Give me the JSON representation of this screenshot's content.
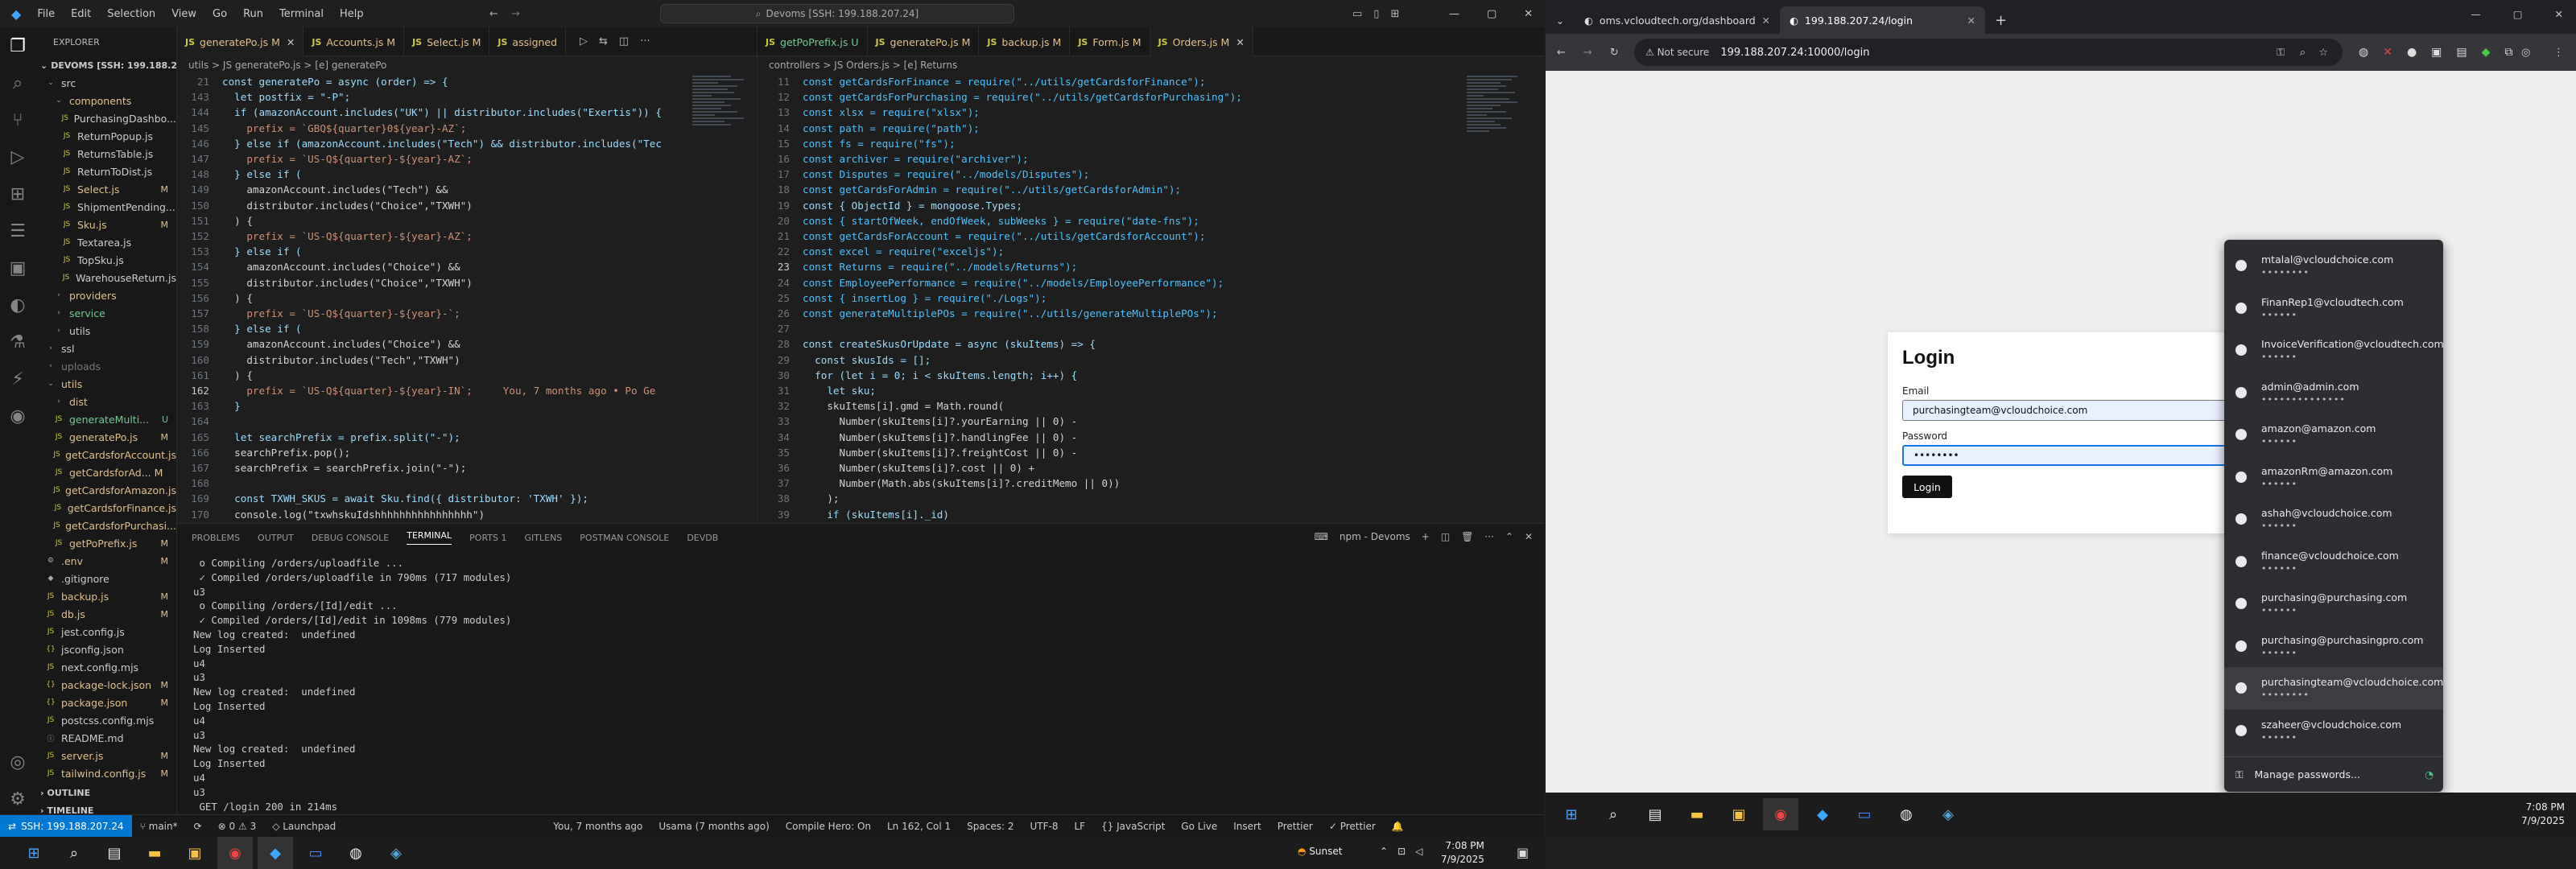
{
  "vscode": {
    "menu": [
      "File",
      "Edit",
      "Selection",
      "View",
      "Go",
      "Run",
      "Terminal",
      "Help"
    ],
    "command_center": "Devoms [SSH: 199.188.207.24]",
    "explorer_title": "EXPLORER",
    "workspace": "DEVOMS [SSH: 199.188.20...",
    "tree": [
      {
        "label": "src",
        "indent": 1,
        "color": "#ccc",
        "badge": "",
        "icon": "folder-open-icon"
      },
      {
        "label": "components",
        "indent": 2,
        "color": "#e2c08d",
        "badge": "",
        "icon": "folder-open-icon"
      },
      {
        "label": "PurchasingDashbo...",
        "indent": 3,
        "color": "#ccc",
        "badge": "",
        "icon": "js-file-icon"
      },
      {
        "label": "ReturnPopup.js",
        "indent": 3,
        "color": "#ccc",
        "badge": "",
        "icon": "js-file-icon"
      },
      {
        "label": "ReturnsTable.js",
        "indent": 3,
        "color": "#ccc",
        "badge": "",
        "icon": "js-file-icon"
      },
      {
        "label": "ReturnToDist.js",
        "indent": 3,
        "color": "#ccc",
        "badge": "",
        "icon": "js-file-icon"
      },
      {
        "label": "Select.js",
        "indent": 3,
        "color": "#e2c08d",
        "badge": "M",
        "icon": "js-file-icon"
      },
      {
        "label": "ShipmentPending...",
        "indent": 3,
        "color": "#ccc",
        "badge": "",
        "icon": "js-file-icon"
      },
      {
        "label": "Sku.js",
        "indent": 3,
        "color": "#e2c08d",
        "badge": "M",
        "icon": "js-file-icon"
      },
      {
        "label": "Textarea.js",
        "indent": 3,
        "color": "#ccc",
        "badge": "",
        "icon": "js-file-icon"
      },
      {
        "label": "TopSku.js",
        "indent": 3,
        "color": "#ccc",
        "badge": "",
        "icon": "js-file-icon"
      },
      {
        "label": "WarehouseReturn.js",
        "indent": 3,
        "color": "#ccc",
        "badge": "",
        "icon": "js-file-icon"
      },
      {
        "label": "providers",
        "indent": 2,
        "color": "#e2c08d",
        "badge": "",
        "icon": "folder-icon"
      },
      {
        "label": "service",
        "indent": 2,
        "color": "#73c991",
        "badge": "",
        "icon": "folder-icon"
      },
      {
        "label": "utils",
        "indent": 2,
        "color": "#ccc",
        "badge": "",
        "icon": "folder-icon"
      },
      {
        "label": "ssl",
        "indent": 1,
        "color": "#ccc",
        "badge": "",
        "icon": "folder-icon"
      },
      {
        "label": "uploads",
        "indent": 1,
        "color": "#777",
        "badge": "",
        "icon": "folder-icon"
      },
      {
        "label": "utils",
        "indent": 1,
        "color": "#e2c08d",
        "badge": "",
        "icon": "folder-open-icon"
      },
      {
        "label": "dist",
        "indent": 2,
        "color": "#e2c08d",
        "badge": "",
        "icon": "folder-icon"
      },
      {
        "label": "generateMulti...",
        "indent": 2,
        "color": "#73c991",
        "badge": "U",
        "icon": "js-file-icon"
      },
      {
        "label": "generatePo.js",
        "indent": 2,
        "color": "#e2c08d",
        "badge": "M",
        "icon": "js-file-icon"
      },
      {
        "label": "getCardsforAccount.js",
        "indent": 2,
        "color": "#e2c08d",
        "badge": "",
        "icon": "js-file-icon"
      },
      {
        "label": "getCardsforAd... M",
        "indent": 2,
        "color": "#e2c08d",
        "badge": "",
        "icon": "js-file-icon"
      },
      {
        "label": "getCardsforAmazon.js",
        "indent": 2,
        "color": "#e2c08d",
        "badge": "",
        "icon": "js-file-icon"
      },
      {
        "label": "getCardsforFinance.js",
        "indent": 2,
        "color": "#e2c08d",
        "badge": "",
        "icon": "js-file-icon"
      },
      {
        "label": "getCardsforPurchasi...",
        "indent": 2,
        "color": "#e2c08d",
        "badge": "",
        "icon": "js-file-icon"
      },
      {
        "label": "getPoPrefix.js",
        "indent": 2,
        "color": "#e2c08d",
        "badge": "M",
        "icon": "js-file-icon"
      },
      {
        "label": ".env",
        "indent": 1,
        "color": "#e2c08d",
        "badge": "M",
        "icon": "gear-icon"
      },
      {
        "label": ".gitignore",
        "indent": 1,
        "color": "#ccc",
        "badge": "",
        "icon": "git-icon"
      },
      {
        "label": "backup.js",
        "indent": 1,
        "color": "#e2c08d",
        "badge": "M",
        "icon": "js-file-icon"
      },
      {
        "label": "db.js",
        "indent": 1,
        "color": "#e2c08d",
        "badge": "M",
        "icon": "js-file-icon"
      },
      {
        "label": "jest.config.js",
        "indent": 1,
        "color": "#ccc",
        "badge": "",
        "icon": "js-file-icon"
      },
      {
        "label": "jsconfig.json",
        "indent": 1,
        "color": "#ccc",
        "badge": "",
        "icon": "json-file-icon"
      },
      {
        "label": "next.config.mjs",
        "indent": 1,
        "color": "#ccc",
        "badge": "",
        "icon": "js-file-icon"
      },
      {
        "label": "package-lock.json",
        "indent": 1,
        "color": "#e2c08d",
        "badge": "M",
        "icon": "json-file-icon"
      },
      {
        "label": "package.json",
        "indent": 1,
        "color": "#e2c08d",
        "badge": "M",
        "icon": "json-file-icon"
      },
      {
        "label": "postcss.config.mjs",
        "indent": 1,
        "color": "#ccc",
        "badge": "",
        "icon": "js-file-icon"
      },
      {
        "label": "README.md",
        "indent": 1,
        "color": "#ccc",
        "badge": "",
        "icon": "info-icon"
      },
      {
        "label": "server.js",
        "indent": 1,
        "color": "#e2c08d",
        "badge": "M",
        "icon": "js-file-icon"
      },
      {
        "label": "tailwind.config.js",
        "indent": 1,
        "color": "#e2c08d",
        "badge": "M",
        "icon": "js-file-icon"
      }
    ],
    "outline": "OUTLINE",
    "timeline": "TIMELINE",
    "left_tabs": [
      "generatePo.js M",
      "Accounts.js M",
      "Select.js M",
      "assigned"
    ],
    "right_tabs": [
      "getPoPrefix.js U",
      "generatePo.js M",
      "backup.js M",
      "Form.js M",
      "Orders.js M"
    ],
    "left_breadcrumb": "utils > JS generatePo.js > [e] generatePo",
    "right_breadcrumb": "controllers > JS Orders.js > [e] Returns",
    "left_lines": [
      {
        "n": "21",
        "t": "const generatePo = async (order) => {"
      },
      {
        "n": "143",
        "t": "  let postfix = \"-P\";"
      },
      {
        "n": "144",
        "t": "  if (amazonAccount.includes(\"UK\") || distributor.includes(\"Exertis\")) {"
      },
      {
        "n": "145",
        "t": "    prefix = `GBQ${quarter}0${year}-AZ`;"
      },
      {
        "n": "146",
        "t": "  } else if (amazonAccount.includes(\"Tech\") && distributor.includes(\"Tec"
      },
      {
        "n": "147",
        "t": "    prefix = `US-Q${quarter}-${year}-AZ`;"
      },
      {
        "n": "148",
        "t": "  } else if ("
      },
      {
        "n": "149",
        "t": "    amazonAccount.includes(\"Tech\") &&"
      },
      {
        "n": "150",
        "t": "    distributor.includes(\"Choice\",\"TXWH\")"
      },
      {
        "n": "151",
        "t": "  ) {"
      },
      {
        "n": "152",
        "t": "    prefix = `US-Q${quarter}-${year}-AZ`;"
      },
      {
        "n": "153",
        "t": "  } else if ("
      },
      {
        "n": "154",
        "t": "    amazonAccount.includes(\"Choice\") &&"
      },
      {
        "n": "155",
        "t": "    distributor.includes(\"Choice\",\"TXWH\")"
      },
      {
        "n": "156",
        "t": "  ) {"
      },
      {
        "n": "157",
        "t": "    prefix = `US-Q${quarter}-${year}-`;"
      },
      {
        "n": "158",
        "t": "  } else if ("
      },
      {
        "n": "159",
        "t": "    amazonAccount.includes(\"Choice\") &&"
      },
      {
        "n": "160",
        "t": "    distributor.includes(\"Tech\",\"TXWH\")"
      },
      {
        "n": "161",
        "t": "  ) {"
      },
      {
        "n": "162",
        "t": "    prefix = `US-Q${quarter}-${year}-IN`;     You, 7 months ago • Po Ge"
      },
      {
        "n": "163",
        "t": "  }"
      },
      {
        "n": "164",
        "t": ""
      },
      {
        "n": "165",
        "t": "  let searchPrefix = prefix.split(\"-\");"
      },
      {
        "n": "166",
        "t": "  searchPrefix.pop();"
      },
      {
        "n": "167",
        "t": "  searchPrefix = searchPrefix.join(\"-\");"
      },
      {
        "n": "168",
        "t": ""
      },
      {
        "n": "169",
        "t": "  const TXWH_SKUS = await Sku.find({ distributor: 'TXWH' });"
      },
      {
        "n": "170",
        "t": "  console.log(\"txwhskuIdshhhhhhhhhhhhhhhh\")"
      }
    ],
    "right_lines": [
      {
        "n": "11",
        "t": "const getCardsForFinance = require(\"../utils/getCardsforFinance\");"
      },
      {
        "n": "12",
        "t": "const getCardsForPurchasing = require(\"../utils/getCardsforPurchasing\");"
      },
      {
        "n": "13",
        "t": "const xlsx = require(\"xlsx\");"
      },
      {
        "n": "14",
        "t": "const path = require(\"path\");"
      },
      {
        "n": "15",
        "t": "const fs = require(\"fs\");"
      },
      {
        "n": "16",
        "t": "const archiver = require(\"archiver\");"
      },
      {
        "n": "17",
        "t": "const Disputes = require(\"../models/Disputes\");"
      },
      {
        "n": "18",
        "t": "const getCardsForAdmin = require(\"../utils/getCardsforAdmin\");"
      },
      {
        "n": "19",
        "t": "const { ObjectId } = mongoose.Types;"
      },
      {
        "n": "20",
        "t": "const { startOfWeek, endOfWeek, subWeeks } = require(\"date-fns\");"
      },
      {
        "n": "21",
        "t": "const getCardsForAccount = require(\"../utils/getCardsforAccount\");"
      },
      {
        "n": "22",
        "t": "const excel = require(\"exceljs\");"
      },
      {
        "n": "23",
        "t": "const Returns = require(\"../models/Returns\");"
      },
      {
        "n": "24",
        "t": "const EmployeePerformance = require(\"../models/EmployeePerformance\");"
      },
      {
        "n": "25",
        "t": "const { insertLog } = require(\"./Logs\");"
      },
      {
        "n": "26",
        "t": "const generateMultiplePOs = require(\"../utils/generateMultiplePOs\");"
      },
      {
        "n": "27",
        "t": ""
      },
      {
        "n": "28",
        "t": "const createSkusOrUpdate = async (skuItems) => {"
      },
      {
        "n": "29",
        "t": "  const skusIds = [];"
      },
      {
        "n": "30",
        "t": "  for (let i = 0; i < skuItems.length; i++) {"
      },
      {
        "n": "31",
        "t": "    let sku;"
      },
      {
        "n": "32",
        "t": "    skuItems[i].gmd = Math.round("
      },
      {
        "n": "33",
        "t": "      Number(skuItems[i]?.yourEarning || 0) -"
      },
      {
        "n": "34",
        "t": "      Number(skuItems[i]?.handlingFee || 0) -"
      },
      {
        "n": "35",
        "t": "      Number(skuItems[i]?.freightCost || 0) -"
      },
      {
        "n": "36",
        "t": "      Number(skuItems[i]?.cost || 0) +"
      },
      {
        "n": "37",
        "t": "      Number(Math.abs(skuItems[i]?.creditMemo || 0))"
      },
      {
        "n": "38",
        "t": "    );"
      },
      {
        "n": "39",
        "t": "    if (skuItems[i]._id)"
      }
    ],
    "panel_tabs": [
      "PROBLEMS",
      "OUTPUT",
      "DEBUG CONSOLE",
      "TERMINAL",
      "PORTS 1",
      "GITLENS",
      "POSTMAN CONSOLE",
      "DEVDB"
    ],
    "panel_active": "TERMINAL",
    "terminal_name": "npm - Devoms",
    "terminal_lines": [
      " o Compiling /orders/uploadfile ...",
      " ✓ Compiled /orders/uploadfile in 790ms (717 modules)",
      "u3",
      " o Compiling /orders/[Id]/edit ...",
      " ✓ Compiled /orders/[Id]/edit in 1098ms (779 modules)",
      "New log created:  undefined",
      "Log Inserted",
      "u4",
      "u3",
      "New log created:  undefined",
      "Log Inserted",
      "u4",
      "u3",
      "New log created:  undefined",
      "Log Inserted",
      "u4",
      "u3",
      " GET /login 200 in 214ms",
      "▯"
    ],
    "status": {
      "remote": "SSH: 199.188.207.24",
      "branch": "main*",
      "sync": "⟳",
      "errors": "⊗ 0 ⚠ 3",
      "launchpad": "Launchpad",
      "blame": "You, 7 months ago",
      "author": "Usama (7 months ago)",
      "compile": "Compile Hero: On",
      "pos": "Ln 162, Col 1",
      "spaces": "Spaces: 2",
      "enc": "UTF-8",
      "eol": "LF",
      "lang": "{} JavaScript",
      "golive": "Go Live",
      "insert": "Insert",
      "prettier": "Prettier",
      "prettier2": "✓ Prettier"
    }
  },
  "chrome": {
    "tabs": [
      {
        "title": "oms.vcloudtech.org/dashboard"
      },
      {
        "title": "199.188.207.24/login"
      }
    ],
    "security": "Not secure",
    "url": "199.188.207.24:10000/login",
    "login_title": "Login",
    "email_label": "Email",
    "email_value": "purchasingteam@vcloudchoice.com",
    "password_label": "Password",
    "password_value": "••••••••",
    "login_button": "Login",
    "passwords": [
      {
        "user": "mtalal@vcloudchoice.com",
        "mask": "••••••••"
      },
      {
        "user": "FinanRep1@vcloudtech.com",
        "mask": "••••••"
      },
      {
        "user": "InvoiceVerification@vcloudtech.com",
        "mask": "••••••"
      },
      {
        "user": "admin@admin.com",
        "mask": "••••••••••••••"
      },
      {
        "user": "amazon@amazon.com",
        "mask": "••••••"
      },
      {
        "user": "amazonRm@amazon.com",
        "mask": "••••••"
      },
      {
        "user": "ashah@vcloudchoice.com",
        "mask": "••••••"
      },
      {
        "user": "finance@vcloudchoice.com",
        "mask": "••••••"
      },
      {
        "user": "purchasing@purchasing.com",
        "mask": "••••••"
      },
      {
        "user": "purchasing@purchasingpro.com",
        "mask": "••••••"
      },
      {
        "user": "purchasingteam@vcloudchoice.com",
        "mask": "••••••••"
      },
      {
        "user": "szaheer@vcloudchoice.com",
        "mask": "••••••"
      }
    ],
    "selected_password_index": 10,
    "manage_passwords": "Manage passwords...",
    "time": "7:08 PM",
    "date": "7/9/2025"
  },
  "taskbar_left": {
    "weather": "Sunset",
    "time": "7:08 PM",
    "date": "7/9/2025"
  }
}
